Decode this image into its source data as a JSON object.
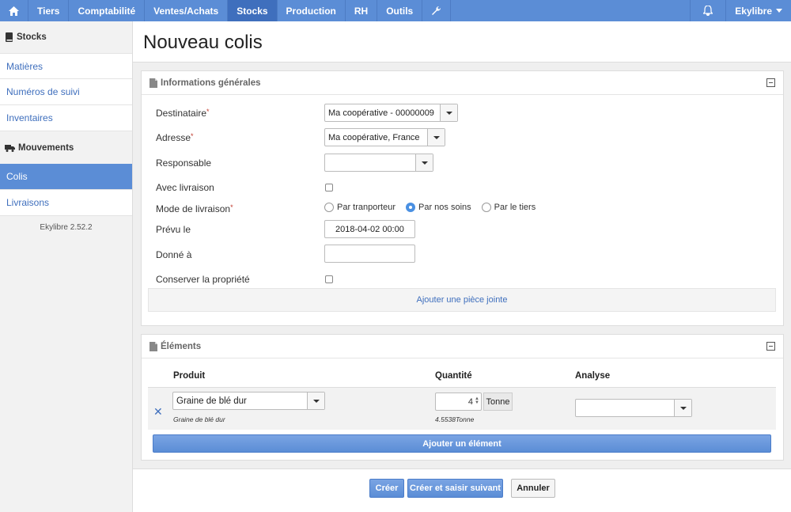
{
  "nav": {
    "items": [
      "Tiers",
      "Comptabilité",
      "Ventes/Achats",
      "Stocks",
      "Production",
      "RH",
      "Outils"
    ],
    "active": "Stocks",
    "user": "Ekylibre",
    "icons": {
      "home": "home-icon",
      "tools": "wrench-icon",
      "notifications": "bell-icon"
    }
  },
  "sidebar": {
    "stocks_heading": "Stocks",
    "stocks_items": [
      "Matières",
      "Numéros de suivi",
      "Inventaires"
    ],
    "movements_heading": "Mouvements",
    "movements_items": [
      "Colis",
      "Livraisons"
    ],
    "active_item": "Colis",
    "version": "Ekylibre 2.52.2"
  },
  "page": {
    "title": "Nouveau colis"
  },
  "general": {
    "title": "Informations générales",
    "fields": {
      "recipient_label": "Destinataire",
      "recipient_value": "Ma coopérative - 00000009",
      "address_label": "Adresse",
      "address_value": "Ma coopérative, France",
      "responsible_label": "Responsable",
      "responsible_value": "",
      "with_delivery_label": "Avec livraison",
      "with_delivery_checked": false,
      "delivery_mode_label": "Mode de livraison",
      "delivery_mode_options": [
        "Par tranporteur",
        "Par nos soins",
        "Par le tiers"
      ],
      "delivery_mode_selected": "Par nos soins",
      "planned_label": "Prévu le",
      "planned_value": "2018-04-02 00:00",
      "given_to_label": "Donné à",
      "given_to_value": "",
      "keep_ownership_label": "Conserver la propriété",
      "keep_ownership_checked": false
    },
    "attach_label": "Ajouter une pièce jointe"
  },
  "elements": {
    "title": "Éléments",
    "headers": {
      "product": "Produit",
      "quantity": "Quantité",
      "analysis": "Analyse"
    },
    "rows": [
      {
        "product": "Graine de blé dur",
        "product_sub": "Graine de blé dur",
        "quantity": "4",
        "unit": "Tonne",
        "available": "4.5538Tonne",
        "analysis": ""
      }
    ],
    "add_label": "Ajouter un élément"
  },
  "footer": {
    "create": "Créer",
    "create_next": "Créer et saisir suivant",
    "cancel": "Annuler"
  },
  "colors": {
    "nav": "#5b8dd6",
    "active": "#3f6fbd",
    "link": "#3f6fbd"
  }
}
